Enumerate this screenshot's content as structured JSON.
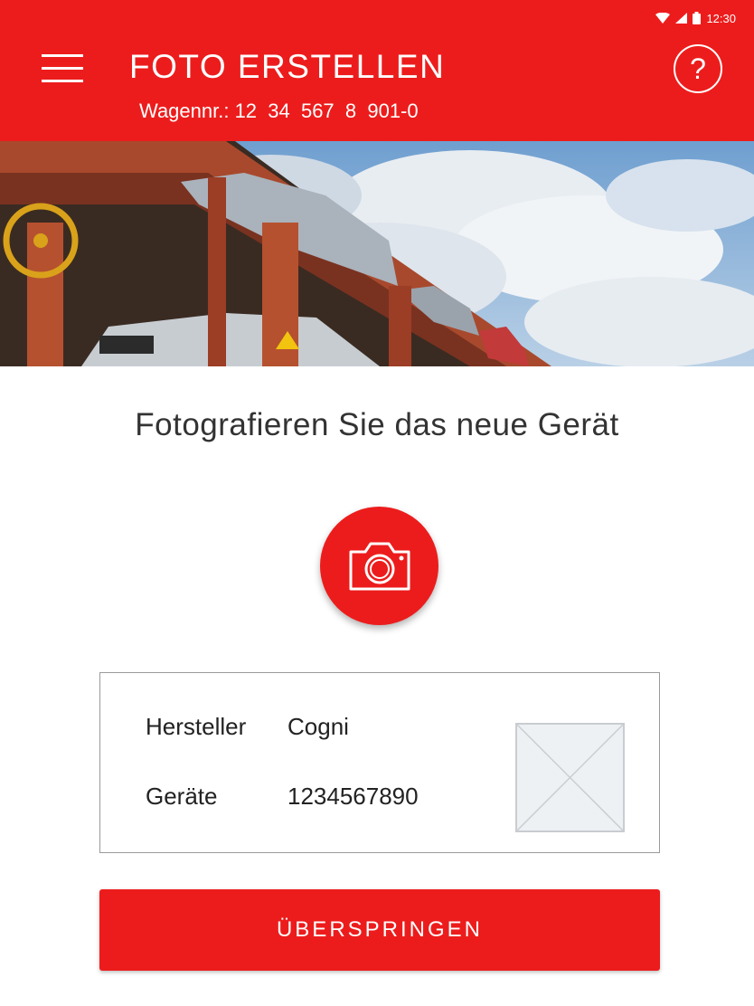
{
  "status_bar": {
    "time": "12:30"
  },
  "header": {
    "title": "FOTO ERSTELLEN",
    "subtitle": "Wagennr.: 12  34  567  8  901-0",
    "help_label": "?",
    "background_color": "#ed1c1c"
  },
  "main": {
    "instruction": "Fotografieren Sie das neue Gerät"
  },
  "info": {
    "manufacturer_label": "Hersteller",
    "manufacturer_value": "Cogni",
    "device_label": "Geräte",
    "device_value": "1234567890"
  },
  "actions": {
    "skip_label": "ÜBERSPRINGEN"
  },
  "icons": {
    "menu": "hamburger-menu-icon",
    "help": "question-mark-icon",
    "camera": "camera-icon",
    "placeholder": "image-placeholder-icon"
  }
}
